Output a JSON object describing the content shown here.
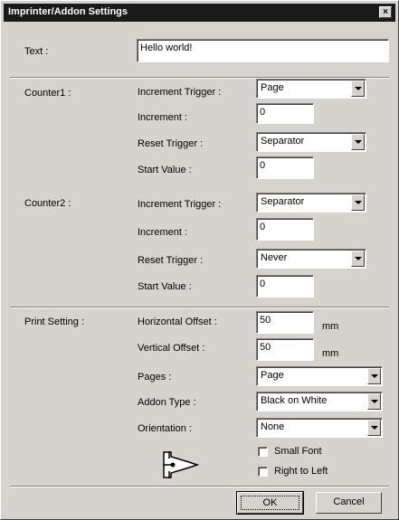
{
  "window": {
    "title": "Imprinter/Addon Settings",
    "close_glyph": "×"
  },
  "text_field": {
    "label": "Text :",
    "value": "Hello world!"
  },
  "counter1": {
    "section": "Counter1 :",
    "increment_trigger": {
      "label": "Increment Trigger :",
      "value": "Page"
    },
    "increment": {
      "label": "Increment :",
      "value": "0"
    },
    "reset_trigger": {
      "label": "Reset Trigger :",
      "value": "Separator"
    },
    "start_value": {
      "label": "Start Value :",
      "value": "0"
    }
  },
  "counter2": {
    "section": "Counter2 :",
    "increment_trigger": {
      "label": "Increment Trigger :",
      "value": "Separator"
    },
    "increment": {
      "label": "Increment :",
      "value": "0"
    },
    "reset_trigger": {
      "label": "Reset Trigger :",
      "value": "Never"
    },
    "start_value": {
      "label": "Start Value :",
      "value": "0"
    }
  },
  "print_setting": {
    "section": "Print Setting :",
    "horizontal_offset": {
      "label": "Horizontal Offset :",
      "value": "50",
      "unit": "mm"
    },
    "vertical_offset": {
      "label": "Vertical Offset :",
      "value": "50",
      "unit": "mm"
    },
    "pages": {
      "label": "Pages :",
      "value": "Page"
    },
    "addon_type": {
      "label": "Addon Type :",
      "value": "Black on White"
    },
    "orientation": {
      "label": "Orientation :",
      "value": "None"
    },
    "orientation_icon": "orientation-arrow-icon",
    "small_font": {
      "label": "Small Font",
      "checked": false
    },
    "right_to_left": {
      "label": "Right to Left",
      "checked": false
    }
  },
  "buttons": {
    "ok": "OK",
    "cancel": "Cancel"
  }
}
